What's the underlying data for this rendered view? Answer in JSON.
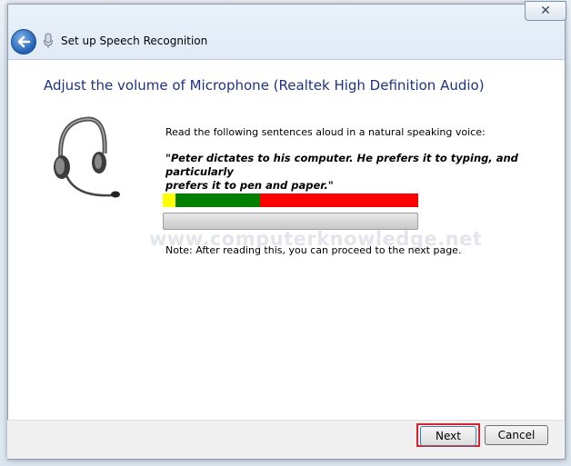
{
  "window": {
    "title": "Set up Speech Recognition",
    "close_glyph": "✕"
  },
  "heading": "Adjust the volume of Microphone (Realtek High Definition Audio)",
  "instruction": "Read the following sentences aloud in a natural speaking voice:",
  "sentence_line1": "\"Peter dictates to his computer. He prefers it to typing, and particularly",
  "sentence_line2": "prefers it to pen and paper.\"",
  "level_meter": {
    "segments": [
      {
        "color": "#ffff00",
        "fraction": 0.05
      },
      {
        "color": "#008000",
        "fraction": 0.33
      },
      {
        "color": "#ff0000",
        "fraction": 0.62
      }
    ]
  },
  "volume_level": 0.0,
  "note": "Note: After reading this, you can proceed to the next page.",
  "watermark": "www.computerknowledge.net",
  "buttons": {
    "next": "Next",
    "cancel": "Cancel"
  },
  "icons": {
    "back": "back-arrow-icon",
    "mic": "microphone-icon",
    "headset": "headset-icon"
  },
  "colors": {
    "heading": "#1e3287",
    "highlight": "#d9232c"
  }
}
